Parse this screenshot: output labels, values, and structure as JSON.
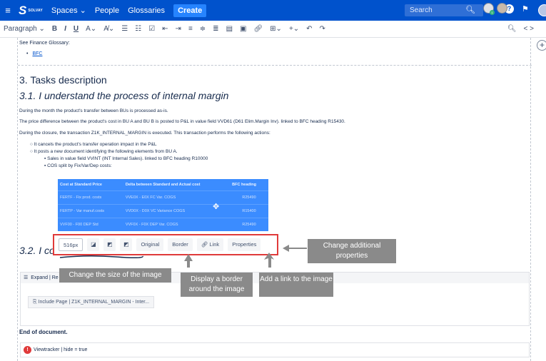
{
  "header": {
    "logo_text": "SOLVAY",
    "nav": [
      "Spaces",
      "People",
      "Glossaries"
    ],
    "create_label": "Create",
    "search_placeholder": "Search"
  },
  "toolbar": {
    "paragraph": "Paragraph"
  },
  "page": {
    "see_finance": "See Finance Glossary:",
    "bfc": "BFC",
    "h3": "3. Tasks description",
    "h31": "3.1. I understand the process of internal margin",
    "p1": "During the month the product's transfer between BUs is processed as-is.",
    "p2": "The price difference between the product's cost in BU A and BU B is posted to P&L in value field VVD61 (D61 Elim.Margin Inv). linked to BFC heading R15430.",
    "p3": "During the closure, the transaction Z1K_INTERNAL_MARGIN is executed. This transaction performs the following actions:",
    "b1": "It cancels the product's transfer operation impact in the P&L",
    "b2": "It posts a new document identifying the following elements from BU A.",
    "b3": "Sales in value field VVINT (INT Internal Sales). linked to BFC heading R10000",
    "b4": "COS split by Fix/Var/Dep costs:",
    "h32": "3.2. I cor",
    "end_doc": "End of document."
  },
  "table": {
    "headers": [
      "Cost at Standard Price",
      "Delta between Standard and Actual cost",
      "BFC heading"
    ],
    "rows": [
      [
        "FERTF - Fix prod. costs",
        "VVE0X - E0X FC Var. COGS",
        "R25490"
      ],
      [
        "FERTP - Var manuf.costs",
        "VVD0X - D0X VC Variance COGS",
        "R15400"
      ],
      [
        "VVF00 - F00 DEP Std",
        "VVF0X - F0X DEP Var. COGS",
        "R25490"
      ]
    ]
  },
  "image_toolbar": {
    "size": "516px",
    "original": "Original",
    "border": "Border",
    "link": "Link",
    "properties": "Properties"
  },
  "callouts": {
    "size": "Change the size of the image",
    "border": "Display a border around the image",
    "link": "Add a link to the image",
    "props": "Change additional properties"
  },
  "expand": {
    "label": "Expand | Re",
    "include_page": "Include Page | Z1K_INTERNAL_MARGIN - Inter..."
  },
  "viewtracker": {
    "label": "Viewtracker | hide = true"
  },
  "colors": {
    "header_blue": "#0052cc",
    "table_blue": "#3b8cff",
    "callout_gray": "#8a8a8a",
    "highlight_red": "#e03a3a"
  }
}
